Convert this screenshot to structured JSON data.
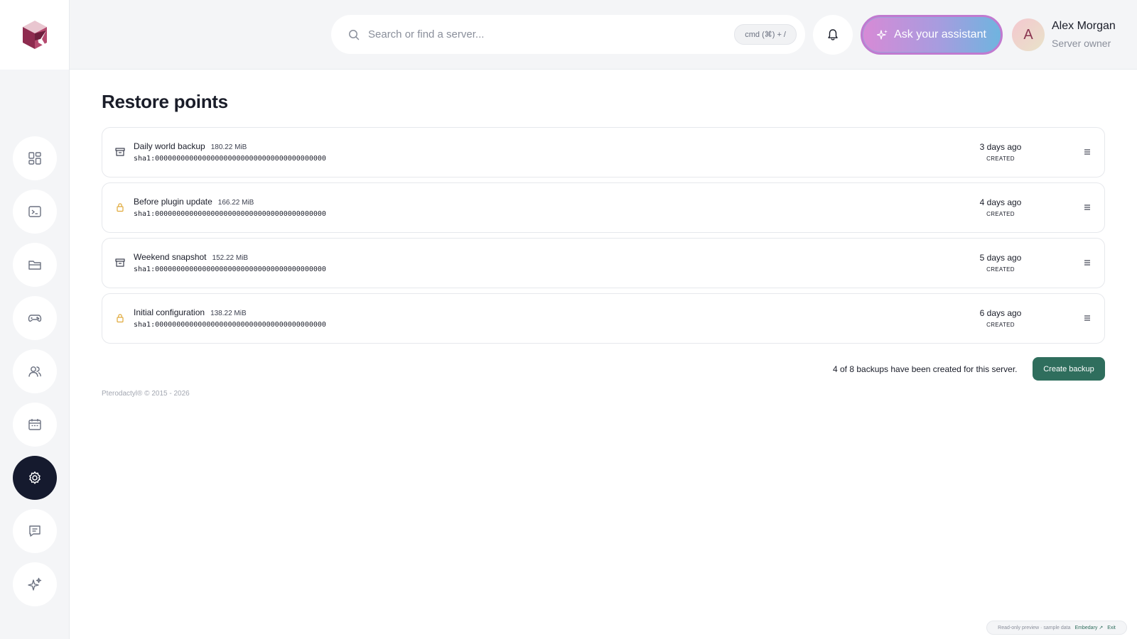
{
  "header": {
    "search_placeholder": "Search or find a server...",
    "search_shortcut": "cmd (⌘) + /",
    "assistant_label": "Ask your assistant",
    "user": {
      "initial": "A",
      "name": "Alex Morgan",
      "role": "Server owner"
    }
  },
  "sidebar": {
    "items": [
      {
        "icon": "dashboard-icon",
        "active": false
      },
      {
        "icon": "terminal-icon",
        "active": false
      },
      {
        "icon": "folder-icon",
        "active": false
      },
      {
        "icon": "gamepad-icon",
        "active": false
      },
      {
        "icon": "users-icon",
        "active": false
      },
      {
        "icon": "calendar-icon",
        "active": false
      },
      {
        "icon": "settings-icon",
        "active": true
      },
      {
        "icon": "chat-icon",
        "active": false
      },
      {
        "icon": "sparkle-icon",
        "active": false
      }
    ]
  },
  "main": {
    "title": "Restore points",
    "backups": [
      {
        "name": "Daily world backup",
        "size": "180.22 MiB",
        "hash": "sha1:0000000000000000000000000000000000000000",
        "when": "3 days ago",
        "status": "CREATED",
        "locked": false
      },
      {
        "name": "Before plugin update",
        "size": "166.22 MiB",
        "hash": "sha1:0000000000000000000000000000000000000000",
        "when": "4 days ago",
        "status": "CREATED",
        "locked": true
      },
      {
        "name": "Weekend snapshot",
        "size": "152.22 MiB",
        "hash": "sha1:0000000000000000000000000000000000000000",
        "when": "5 days ago",
        "status": "CREATED",
        "locked": false
      },
      {
        "name": "Initial configuration",
        "size": "138.22 MiB",
        "hash": "sha1:0000000000000000000000000000000000000000",
        "when": "6 days ago",
        "status": "CREATED",
        "locked": true
      }
    ],
    "summary": "4 of 8 backups have been created for this server.",
    "create_button": "Create backup",
    "footer": "Pterodactyl® © 2015 - 2026"
  },
  "preview_badge": {
    "text": "Read-only preview · sample data",
    "link": "Embedary ↗",
    "exit": "Exit"
  },
  "colors": {
    "accent": "#2f6e5d",
    "sidebar_active": "#151a2e",
    "lock": "#e0a93a"
  }
}
